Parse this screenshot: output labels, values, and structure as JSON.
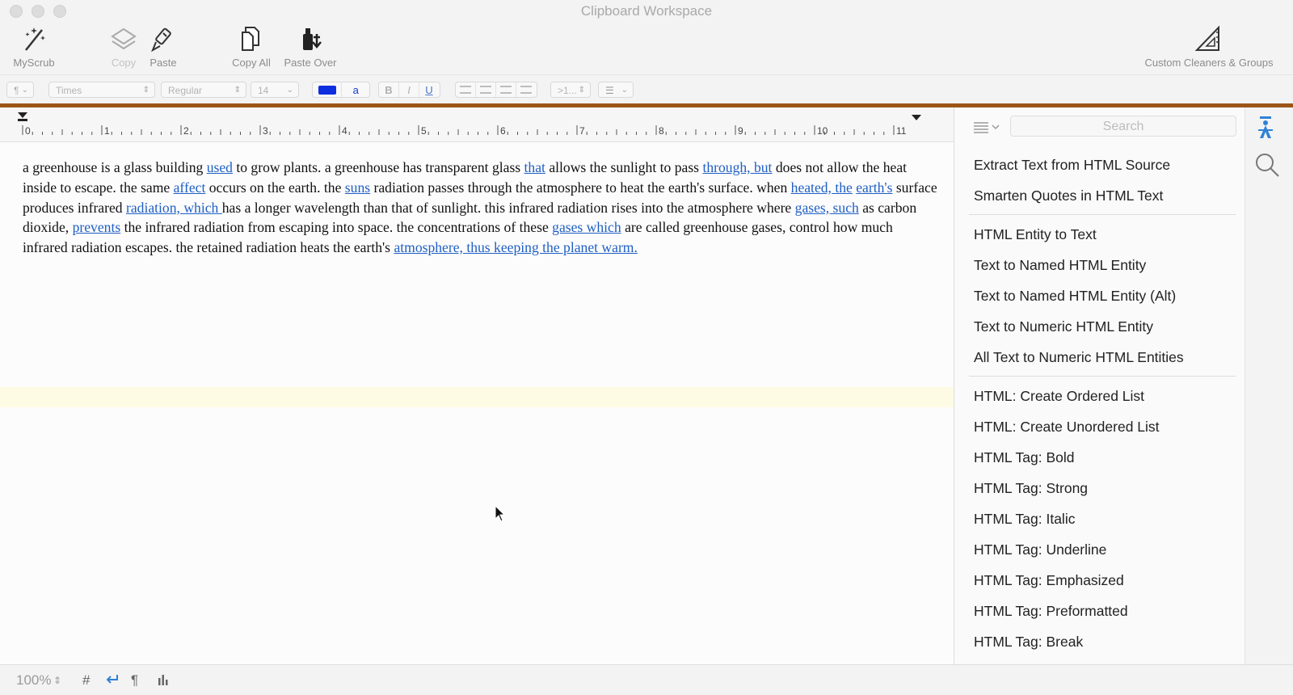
{
  "window": {
    "title": "Clipboard Workspace"
  },
  "toolbar": {
    "myscrub": "MyScrub",
    "copy": "Copy",
    "paste": "Paste",
    "copy_all": "Copy All",
    "paste_over": "Paste Over",
    "custom_cleaners": "Custom Cleaners & Groups"
  },
  "formatbar": {
    "paragraph": "¶",
    "font": "Times",
    "style": "Regular",
    "size": "14",
    "bold": "B",
    "italic": "I",
    "underline": "U",
    "font_color_label": "a",
    "spacing": ">1...",
    "colors": {
      "text_color": "#0d2de0"
    }
  },
  "ruler": {
    "labels": [
      "0",
      "1",
      "2",
      "3",
      "4",
      "5",
      "6",
      "7",
      "8",
      "9",
      "10",
      "11"
    ]
  },
  "document": {
    "segments": [
      {
        "t": "a greenhouse is a glass building "
      },
      {
        "t": "used",
        "link": true
      },
      {
        "t": " to grow plants. a greenhouse has transparent glass "
      },
      {
        "t": "that",
        "link": true
      },
      {
        "t": " allows the sunlight to pass "
      },
      {
        "t": "through, but",
        "link": true
      },
      {
        "t": " does not allow the heat inside to escape. the same "
      },
      {
        "t": "affect",
        "link": true
      },
      {
        "t": " occurs on the earth. the "
      },
      {
        "t": "suns",
        "link": true
      },
      {
        "t": " radiation passes through the atmosphere to heat the earth's surface. when "
      },
      {
        "t": "heated, the",
        "link": true
      },
      {
        "t": " "
      },
      {
        "t": "earth's",
        "link": true
      },
      {
        "t": " surface produces infrared "
      },
      {
        "t": "radiation, which ",
        "link": true
      },
      {
        "t": "has a longer wavelength than that of sunlight. this infrared radiation rises into the atmosphere where "
      },
      {
        "t": "gases, such",
        "link": true
      },
      {
        "t": " as carbon dioxide, "
      },
      {
        "t": "prevents",
        "link": true
      },
      {
        "t": " the infrared radiation from escaping into space. the concentrations of these "
      },
      {
        "t": "gases which",
        "link": true
      },
      {
        "t": " are called greenhouse gases, control how much infrared radiation escapes. the retained radiation heats the earth's "
      },
      {
        "t": "atmosphere, thus keeping the planet warm.",
        "link": true
      }
    ]
  },
  "sidebar": {
    "search_placeholder": "Search",
    "groups": [
      [
        "Extract Text from HTML Source",
        "Smarten Quotes in HTML Text"
      ],
      [
        "HTML Entity to Text",
        "Text to Named HTML Entity",
        "Text to Named HTML Entity (Alt)",
        "Text to Numeric HTML Entity",
        "All Text to Numeric HTML Entities"
      ],
      [
        "HTML: Create Ordered List",
        "HTML: Create Unordered List",
        "HTML Tag: Bold",
        "HTML Tag: Strong",
        "HTML Tag: Italic",
        "HTML Tag: Underline",
        "HTML Tag: Emphasized",
        "HTML Tag: Preformatted",
        "HTML Tag: Break"
      ]
    ]
  },
  "statusbar": {
    "zoom": "100%",
    "hash": "#",
    "paragraph": "¶"
  },
  "icons": {
    "myscrub": "magic-wand-icon",
    "copy": "layers-icon",
    "paste": "brush-icon",
    "copy_all": "documents-icon",
    "paste_over": "paste-over-icon",
    "custom": "ruler-triangle-icon",
    "search": "magnifier-icon",
    "gauge": "person-gauge-icon"
  }
}
